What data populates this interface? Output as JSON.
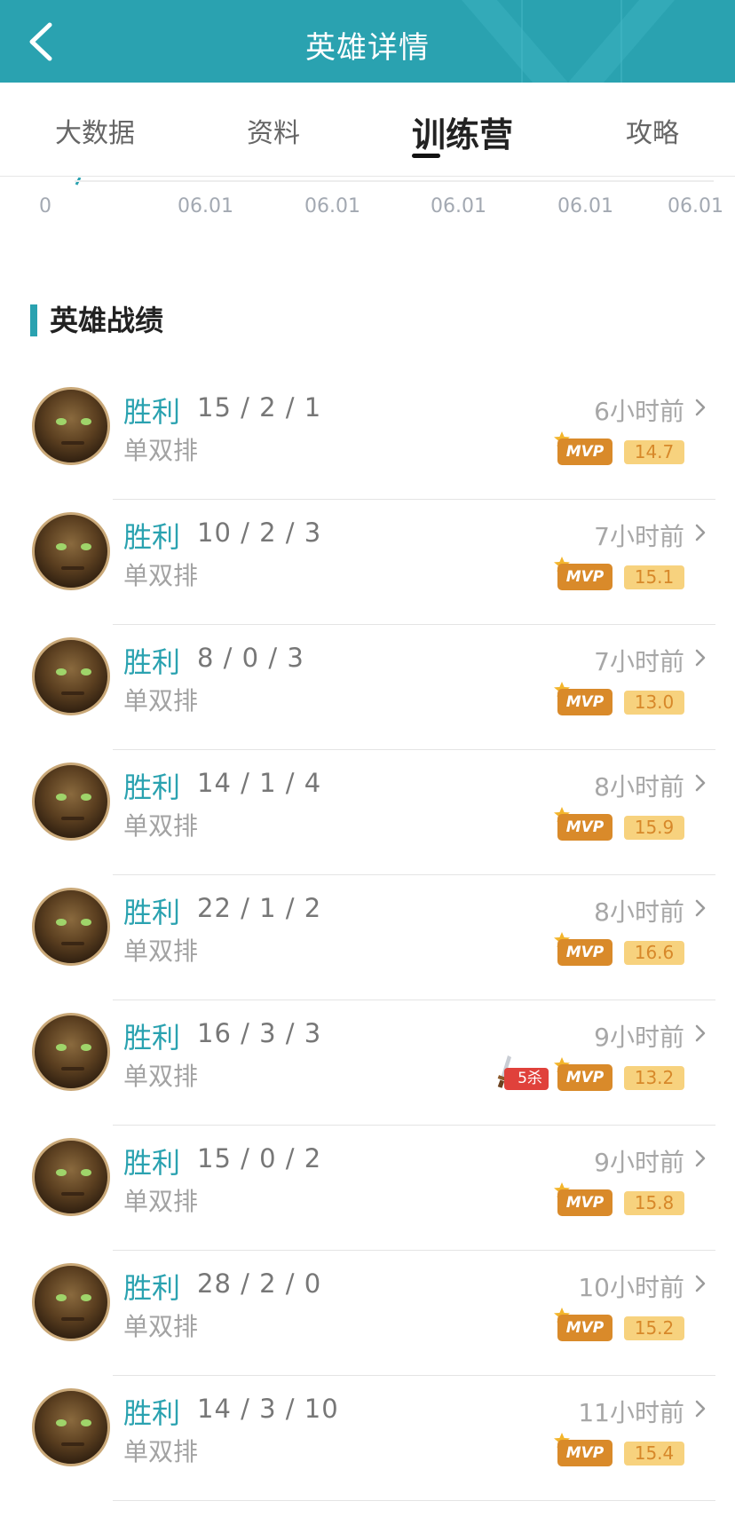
{
  "header": {
    "title": "英雄详情"
  },
  "tabs": [
    {
      "label": "大数据",
      "active": false
    },
    {
      "label": "资料",
      "active": false
    },
    {
      "label": "训练营",
      "active": true
    },
    {
      "label": "攻略",
      "active": false
    }
  ],
  "axis": {
    "ticks": [
      "0",
      "06.01",
      "06.01",
      "06.01",
      "06.01",
      "06.01"
    ]
  },
  "section": {
    "title": "英雄战绩"
  },
  "colors": {
    "accent": "#2aa2b0",
    "mvp": "#d98a2a",
    "score_bg": "#f7d27e",
    "penta": "#e0413b"
  },
  "matches": [
    {
      "result": "胜利",
      "kda": "15 / 2 / 1",
      "mode": "单双排",
      "time": "6小时前",
      "mvp": "MVP",
      "score": "14.7",
      "penta": null
    },
    {
      "result": "胜利",
      "kda": "10 / 2 / 3",
      "mode": "单双排",
      "time": "7小时前",
      "mvp": "MVP",
      "score": "15.1",
      "penta": null
    },
    {
      "result": "胜利",
      "kda": "8 / 0 / 3",
      "mode": "单双排",
      "time": "7小时前",
      "mvp": "MVP",
      "score": "13.0",
      "penta": null
    },
    {
      "result": "胜利",
      "kda": "14 / 1 / 4",
      "mode": "单双排",
      "time": "8小时前",
      "mvp": "MVP",
      "score": "15.9",
      "penta": null
    },
    {
      "result": "胜利",
      "kda": "22 / 1 / 2",
      "mode": "单双排",
      "time": "8小时前",
      "mvp": "MVP",
      "score": "16.6",
      "penta": null
    },
    {
      "result": "胜利",
      "kda": "16 / 3 / 3",
      "mode": "单双排",
      "time": "9小时前",
      "mvp": "MVP",
      "score": "13.2",
      "penta": "5杀"
    },
    {
      "result": "胜利",
      "kda": "15 / 0 / 2",
      "mode": "单双排",
      "time": "9小时前",
      "mvp": "MVP",
      "score": "15.8",
      "penta": null
    },
    {
      "result": "胜利",
      "kda": "28 / 2 / 0",
      "mode": "单双排",
      "time": "10小时前",
      "mvp": "MVP",
      "score": "15.2",
      "penta": null
    },
    {
      "result": "胜利",
      "kda": "14 / 3 / 10",
      "mode": "单双排",
      "time": "11小时前",
      "mvp": "MVP",
      "score": "15.4",
      "penta": null
    }
  ]
}
